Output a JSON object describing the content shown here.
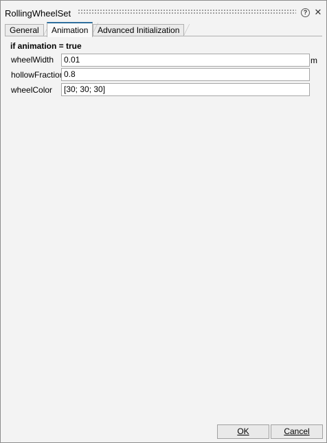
{
  "window": {
    "title": "RollingWheelSet",
    "help_icon": "?",
    "close_icon": "✕"
  },
  "tabs": [
    {
      "label": "General"
    },
    {
      "label": "Animation"
    },
    {
      "label": "Advanced Initialization"
    }
  ],
  "section": {
    "heading": "if animation = true"
  },
  "fields": [
    {
      "label": "wheelWidth",
      "value": "0.01",
      "unit": "m"
    },
    {
      "label": "hollowFraction",
      "value": "0.8"
    },
    {
      "label": "wheelColor",
      "value": "[30; 30; 30]"
    }
  ],
  "buttons": {
    "ok": "OK",
    "cancel": "Cancel"
  }
}
